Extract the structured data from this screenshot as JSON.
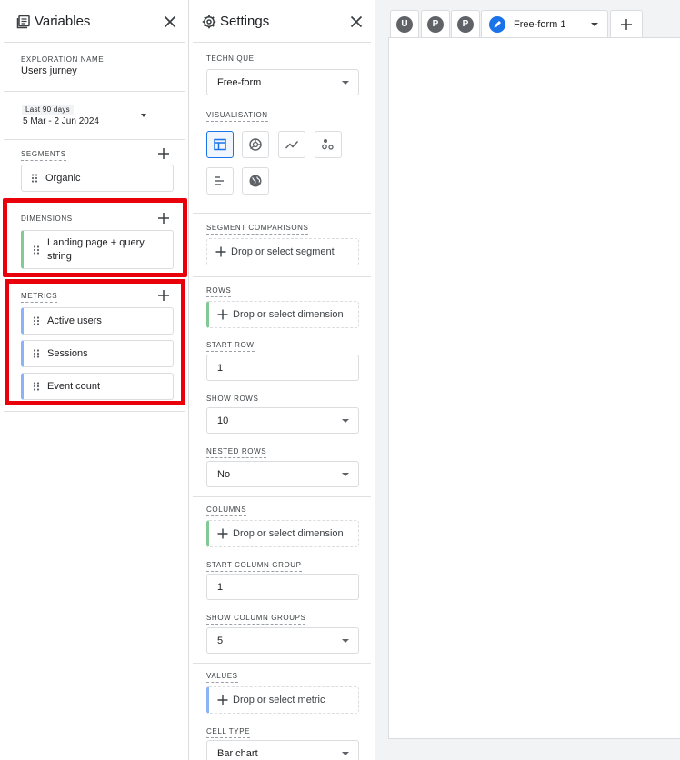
{
  "variables": {
    "title": "Variables",
    "exploration_label": "EXPLORATION NAME:",
    "exploration_name": "Users jurney",
    "date_range_label": "Last 90 days",
    "date_range": "5 Mar - 2 Jun 2024",
    "segments": {
      "label": "SEGMENTS",
      "items": [
        "Organic"
      ]
    },
    "dimensions": {
      "label": "DIMENSIONS",
      "items": [
        "Landing page + query string"
      ]
    },
    "metrics": {
      "label": "METRICS",
      "items": [
        "Active users",
        "Sessions",
        "Event count"
      ]
    }
  },
  "settings": {
    "title": "Settings",
    "technique": {
      "label": "TECHNIQUE",
      "value": "Free-form"
    },
    "visualisation": {
      "label": "VISUALISATION",
      "options": [
        "table-icon",
        "donut-chart-icon",
        "line-chart-icon",
        "scatter-plot-icon",
        "bar-chart-icon",
        "geo-map-icon"
      ],
      "selected": "table-icon"
    },
    "segment_comparisons": {
      "label": "SEGMENT COMPARISONS",
      "placeholder": "Drop or select segment"
    },
    "rows": {
      "label": "ROWS",
      "placeholder": "Drop or select dimension"
    },
    "start_row": {
      "label": "START ROW",
      "value": "1"
    },
    "show_rows": {
      "label": "SHOW ROWS",
      "value": "10"
    },
    "nested_rows": {
      "label": "NESTED ROWS",
      "value": "No"
    },
    "columns": {
      "label": "COLUMNS",
      "placeholder": "Drop or select dimension"
    },
    "start_column_group": {
      "label": "START COLUMN GROUP",
      "value": "1"
    },
    "show_column_groups": {
      "label": "SHOW COLUMN GROUPS",
      "value": "5"
    },
    "values": {
      "label": "VALUES",
      "placeholder": "Drop or select metric"
    },
    "cell_type": {
      "label": "CELL TYPE",
      "value": "Bar chart"
    }
  },
  "tabs": {
    "avatars": [
      "U",
      "P",
      "P"
    ],
    "active": "Free-form 1"
  },
  "colors": {
    "highlight": "#e8000b",
    "dimension_accent": "#81c995",
    "metric_accent": "#8ab4f8",
    "primary": "#1a73e8"
  }
}
